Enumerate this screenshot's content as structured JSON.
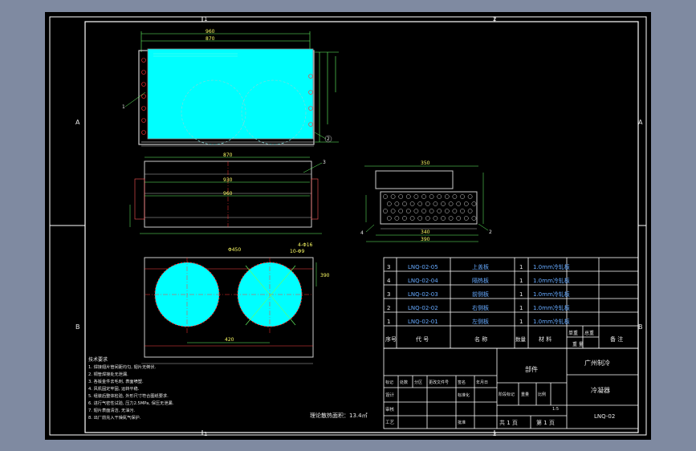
{
  "grid": {
    "cols": [
      "1",
      "2"
    ],
    "rows": [
      "A",
      "B"
    ]
  },
  "parts": [
    {
      "no": "3",
      "code": "LNQ-02-05",
      "name": "上盖板",
      "qty": "1",
      "material": "1.0mm冷轧板"
    },
    {
      "no": "4",
      "code": "LNQ-02-04",
      "name": "隔热板",
      "qty": "1",
      "material": "1.0mm冷轧板"
    },
    {
      "no": "3",
      "code": "LNQ-02-03",
      "name": "前侧板",
      "qty": "1",
      "material": "1.0mm冷轧板"
    },
    {
      "no": "2",
      "code": "LNQ-02-02",
      "name": "右侧板",
      "qty": "1",
      "material": "1.0mm冷轧板"
    },
    {
      "no": "1",
      "code": "LNQ-02-01",
      "name": "左侧板",
      "qty": "1",
      "material": "1.0mm冷轧板"
    }
  ],
  "bom_header": {
    "no": "序号",
    "code": "代 号",
    "name": "名 称",
    "qty": "数量",
    "material": "材 料",
    "single": "单重",
    "total": "总重",
    "weight": "重 量",
    "remark": "备 注"
  },
  "title_block": {
    "company": "广州制冷",
    "part_type": "部件",
    "drawing_name": "冷凝器",
    "drawing_no": "LNQ-02",
    "sheets": "共 1 页",
    "sheet": "第 1 页",
    "sign_row": [
      "标记",
      "处数",
      "分区",
      "更改文件号",
      "签名",
      "年月日"
    ],
    "roles": [
      "设计",
      "审核",
      "工艺"
    ],
    "std": "标准化",
    "approve": "批准",
    "stage": "阶段标记",
    "weight": "重量",
    "scale": "比例",
    "scale_val": "1:5"
  },
  "area_note": "理论散热面积：13.4㎡",
  "tech_req_title": "技术要求",
  "tech_req_lines": [
    "1. 焊接翅片管间距均匀, 翅片无倒伏.",
    "2. 铜管焊接处无泄漏.",
    "3. 各钣金件去毛刺, 表面喷塑.",
    "4. 风机固定牢固, 运转平稳.",
    "5. 组装后整体检验, 外形尺寸符合图纸要求.",
    "6. 进行气密性试验, 压力2.5MPa, 保压无泄漏.",
    "7. 翅片表面清洁, 无油污.",
    "8. 出厂前充入干燥氮气保护."
  ],
  "balloons": [
    "1",
    "2",
    "3",
    "4",
    "2"
  ],
  "dims": {
    "top_w1": "960",
    "top_w2": "870",
    "side_w1": "870",
    "side_w2": "930",
    "side_w3": "960",
    "end_w1": "350",
    "end_w2": "340",
    "end_w3": "390",
    "fan_dia": "Φ450",
    "fan_pitch": "420",
    "front_h": "390",
    "d1": "10-Φ9",
    "d2": "4-Φ16"
  }
}
